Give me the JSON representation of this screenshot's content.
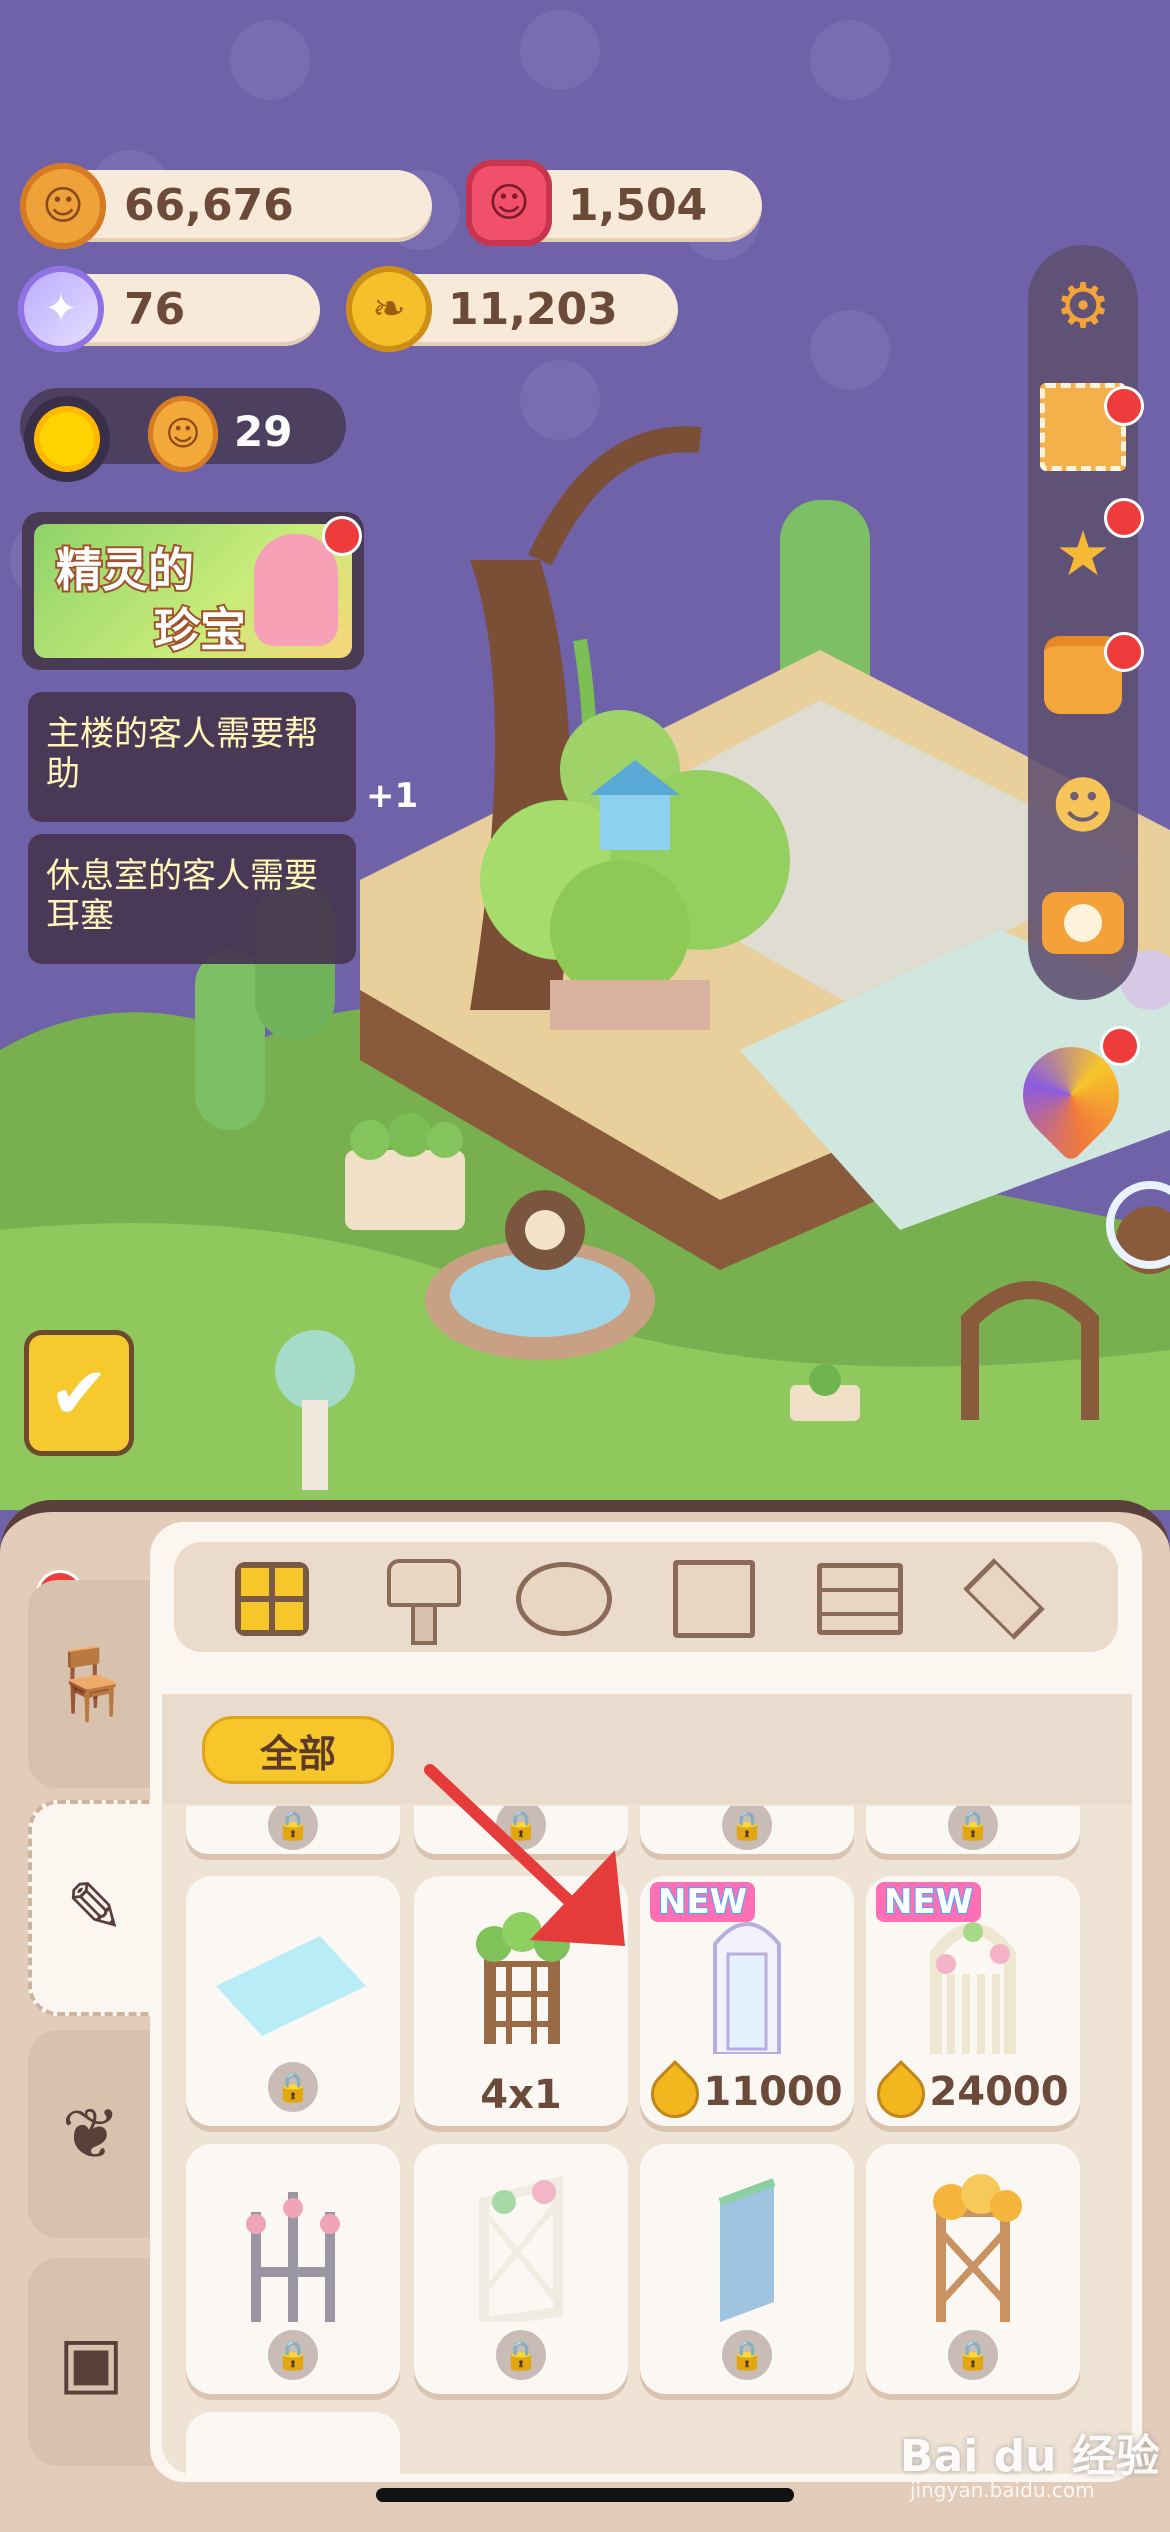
{
  "currencies": {
    "cookies": "66,676",
    "ruby": "1,504",
    "candy": "76",
    "leaves": "11,203"
  },
  "level": {
    "count": "29"
  },
  "event_banner": {
    "line1": "精灵的",
    "line2": "珍宝"
  },
  "tasks": [
    "主楼的客人需要帮助",
    "休息室的客人需要耳塞"
  ],
  "reward_popup": "+1",
  "right_toolbar": [
    "gear-icon",
    "stamp-icon",
    "star-icon",
    "backpack-icon",
    "friends-icon",
    "camera-icon",
    "event-fan-icon"
  ],
  "furniture_panel": {
    "filter_label": "全部",
    "side_tabs": [
      "chair-icon",
      "brush-icon",
      "leaf-icon",
      "box-icon"
    ],
    "category_tabs": [
      "grid-icon",
      "lamp-icon",
      "rug-icon",
      "wall-panel-icon",
      "brick-icon",
      "floor-tile-icon"
    ],
    "items": [
      {
        "name": "ice-floor-tile",
        "label": "",
        "locked": true,
        "new": false
      },
      {
        "name": "vine-arch-gate",
        "label": "4x1",
        "locked": false,
        "new": false
      },
      {
        "name": "white-door-arch",
        "label": "11000",
        "locked": false,
        "new": true,
        "currency": "leaf-icon"
      },
      {
        "name": "white-fence-arch",
        "label": "24000",
        "locked": false,
        "new": true,
        "currency": "leaf-icon"
      },
      {
        "name": "heart-fence",
        "label": "",
        "locked": true,
        "new": false
      },
      {
        "name": "flower-lattice",
        "label": "",
        "locked": true,
        "new": false
      },
      {
        "name": "blue-panel",
        "label": "",
        "locked": true,
        "new": false
      },
      {
        "name": "autumn-lattice",
        "label": "",
        "locked": true,
        "new": false
      }
    ],
    "new_tag": "NEW"
  },
  "watermark": {
    "brand": "Bai du 经验",
    "url": "jingyan.baidu.com"
  },
  "colors": {
    "sky": "#6f62a8",
    "panel": "#e3cdba",
    "pill": "#f8ead8",
    "accent_gold": "#f7c62a",
    "badge_red": "#ee3b3b",
    "arrow": "#e53b3b"
  }
}
